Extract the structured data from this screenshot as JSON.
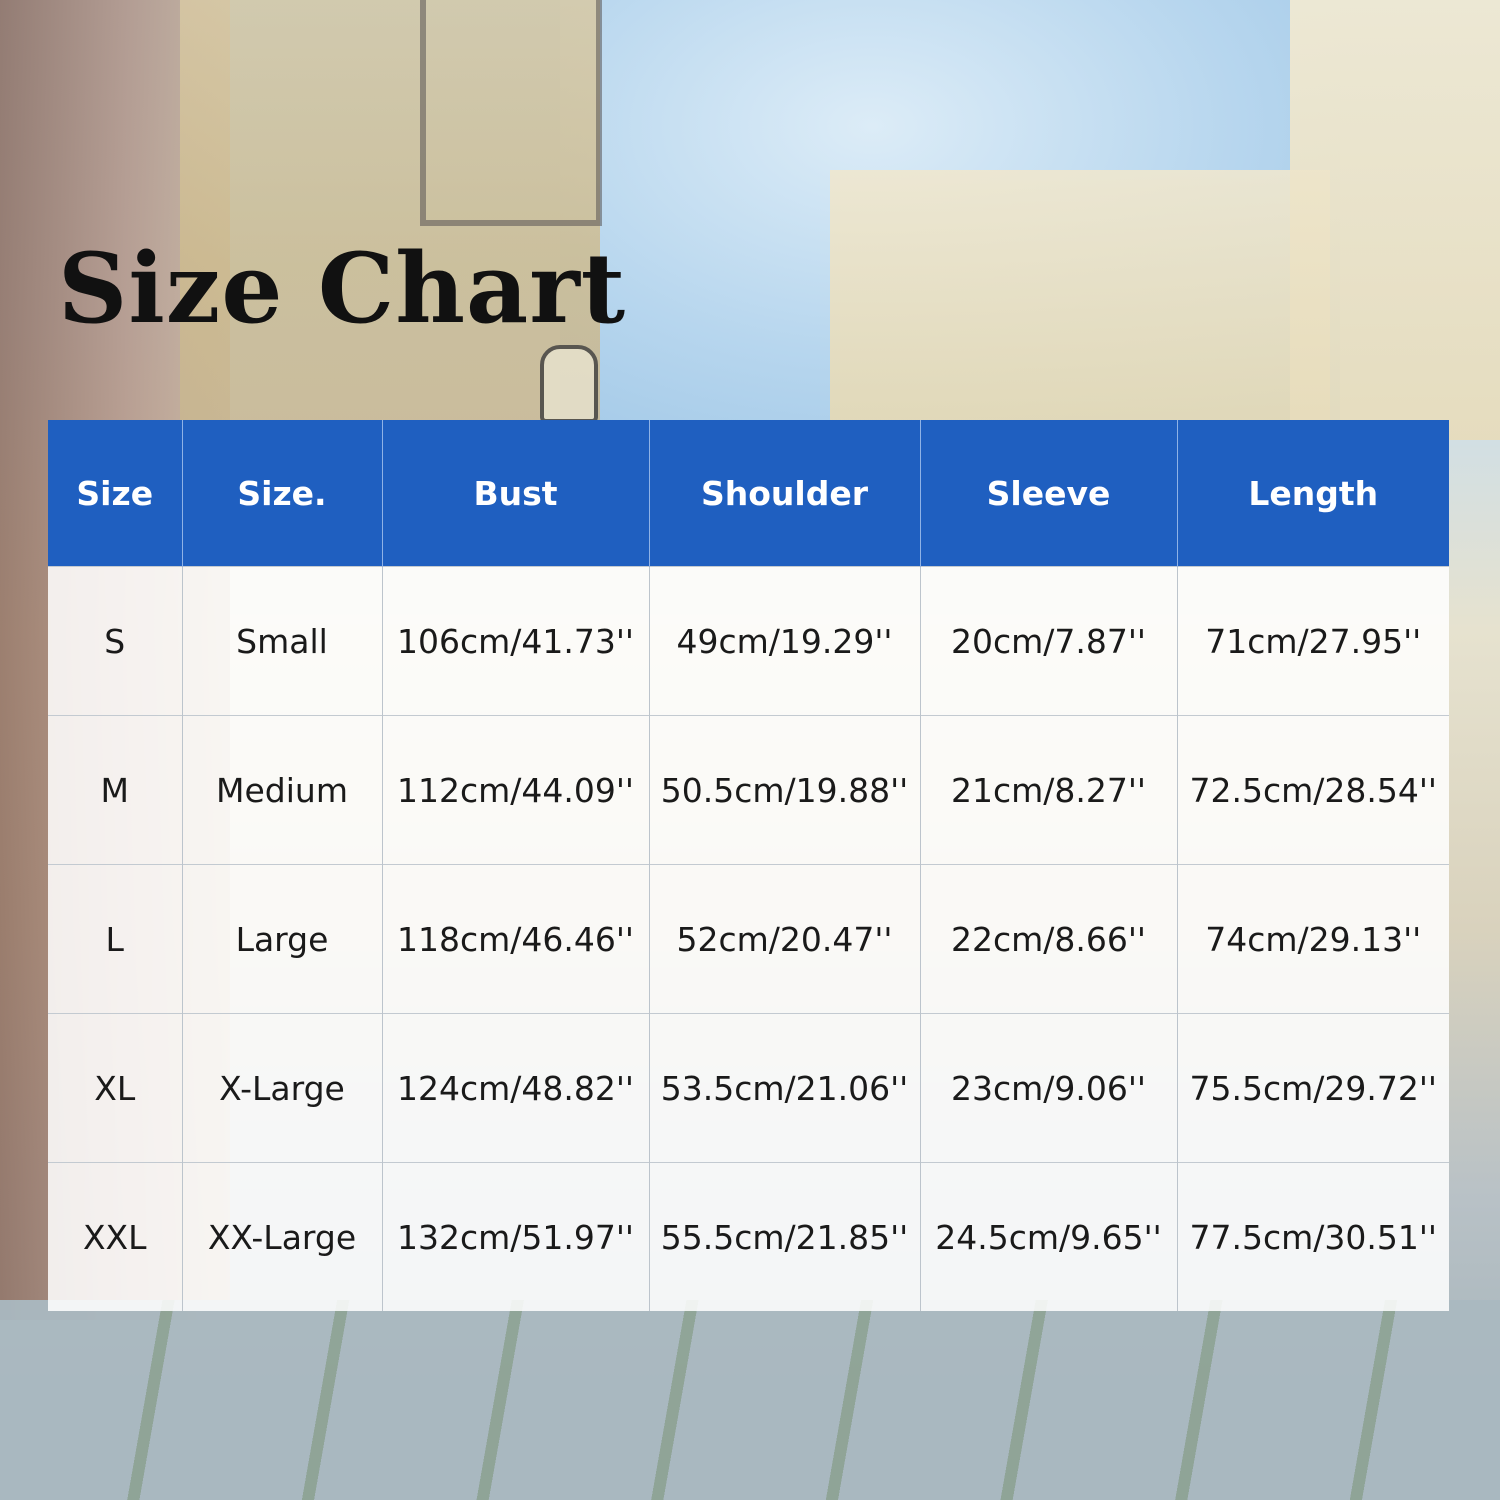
{
  "title": "Size Chart",
  "colors": {
    "header_bg": "#1f5fc0",
    "header_text": "#ffffff",
    "cell_text": "#1a1a1a",
    "title": "#111111"
  },
  "table": {
    "headers": [
      "Size",
      "Size.",
      "Bust",
      "Shoulder",
      "Sleeve",
      "Length"
    ],
    "rows": [
      [
        "S",
        "Small",
        "106cm/41.73''",
        "49cm/19.29''",
        "20cm/7.87''",
        "71cm/27.95''"
      ],
      [
        "M",
        "Medium",
        "112cm/44.09''",
        "50.5cm/19.88''",
        "21cm/8.27''",
        "72.5cm/28.54''"
      ],
      [
        "L",
        "Large",
        "118cm/46.46''",
        "52cm/20.47''",
        "22cm/8.66''",
        "74cm/29.13''"
      ],
      [
        "XL",
        "X-Large",
        "124cm/48.82''",
        "53.5cm/21.06''",
        "23cm/9.06''",
        "75.5cm/29.72''"
      ],
      [
        "XXL",
        "XX-Large",
        "132cm/51.97''",
        "55.5cm/21.85''",
        "24.5cm/9.65''",
        "77.5cm/30.51''"
      ]
    ]
  }
}
